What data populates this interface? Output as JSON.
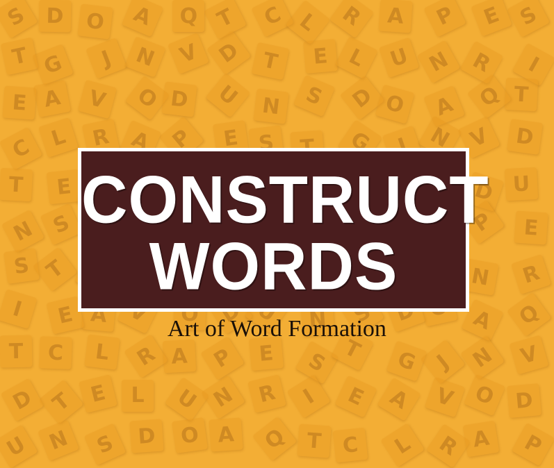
{
  "title": {
    "line1": "CONSTRUCT",
    "line2": "WORDS"
  },
  "subtitle": "Art of Word Formation",
  "colors": {
    "background": "#f3ae35",
    "title_box": "#4a1d1e",
    "title_border": "#ffffff",
    "subtitle_text": "#1a1008"
  },
  "background_tiles": [
    "S",
    "D",
    "O",
    "A",
    "Q",
    "T",
    "C",
    "L",
    "R",
    "A",
    "P",
    "E",
    "S",
    "T",
    "G",
    "J",
    "N",
    "V",
    "D",
    "T",
    "E",
    "L",
    "U",
    "N",
    "R",
    "I",
    "E",
    "A",
    "V",
    "O",
    "D",
    "U",
    "N"
  ],
  "tile_icon": "letter-tile-icon"
}
